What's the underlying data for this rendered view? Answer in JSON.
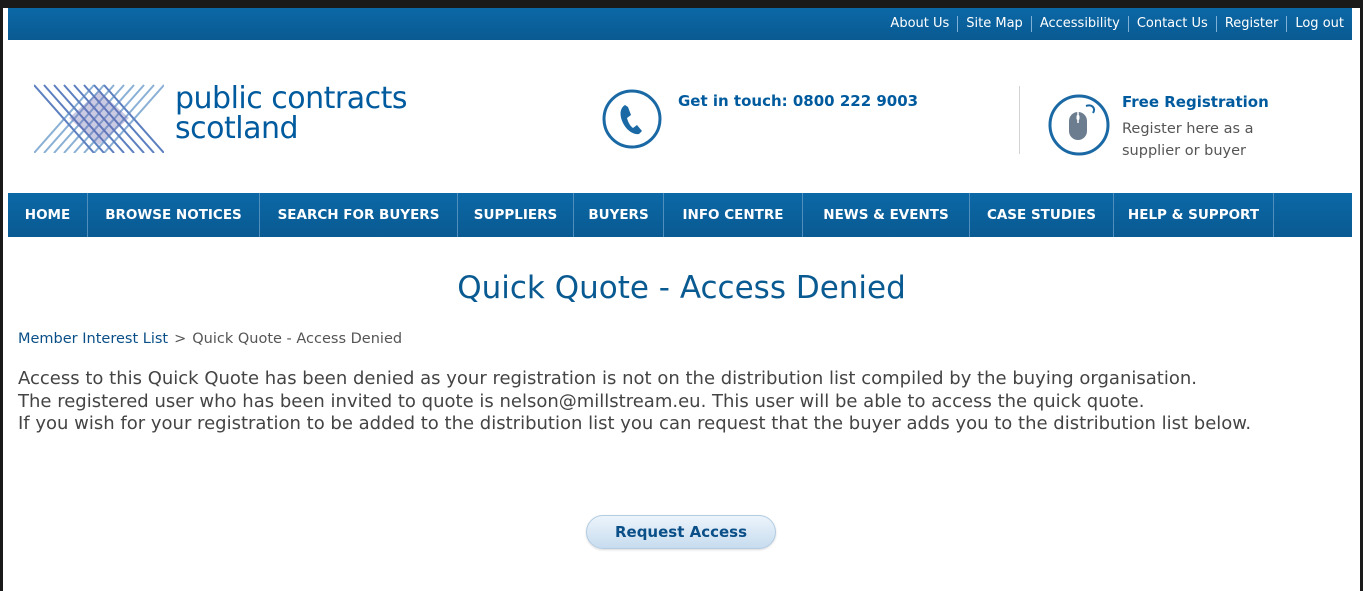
{
  "utility_links": [
    "About Us",
    "Site Map",
    "Accessibility",
    "Contact Us",
    "Register",
    "Log out"
  ],
  "header": {
    "logo_line1": "public contracts",
    "logo_line2": "scotland",
    "phone_text": "Get in touch: 0800 222 9003",
    "reg_title": "Free Registration",
    "reg_desc": "Register here as a supplier or buyer"
  },
  "nav": [
    "HOME",
    "BROWSE NOTICES",
    "SEARCH FOR BUYERS",
    "SUPPLIERS",
    "BUYERS",
    "INFO CENTRE",
    "NEWS & EVENTS",
    "CASE STUDIES",
    "HELP & SUPPORT"
  ],
  "page": {
    "title": "Quick Quote - Access Denied",
    "breadcrumb": {
      "link": "Member Interest List",
      "separator": ">",
      "current": "Quick Quote - Access Denied"
    },
    "lines": [
      "Access to this Quick Quote has been denied as your registration is not on the distribution list compiled by the buying organisation.",
      "The registered user who has been invited to quote is nelson@millstream.eu. This user will be able to access the quick quote.",
      "If you wish for your registration to be added to the distribution list you can request that the buyer adds you to the distribution list below."
    ],
    "button": "Request Access"
  },
  "colors": {
    "brand_blue": "#0a5a92",
    "nav_bg": "#0b68a6"
  },
  "icons": {
    "logo": "lattice-logo-icon",
    "phone": "phone-icon",
    "mouse": "mouse-icon"
  }
}
